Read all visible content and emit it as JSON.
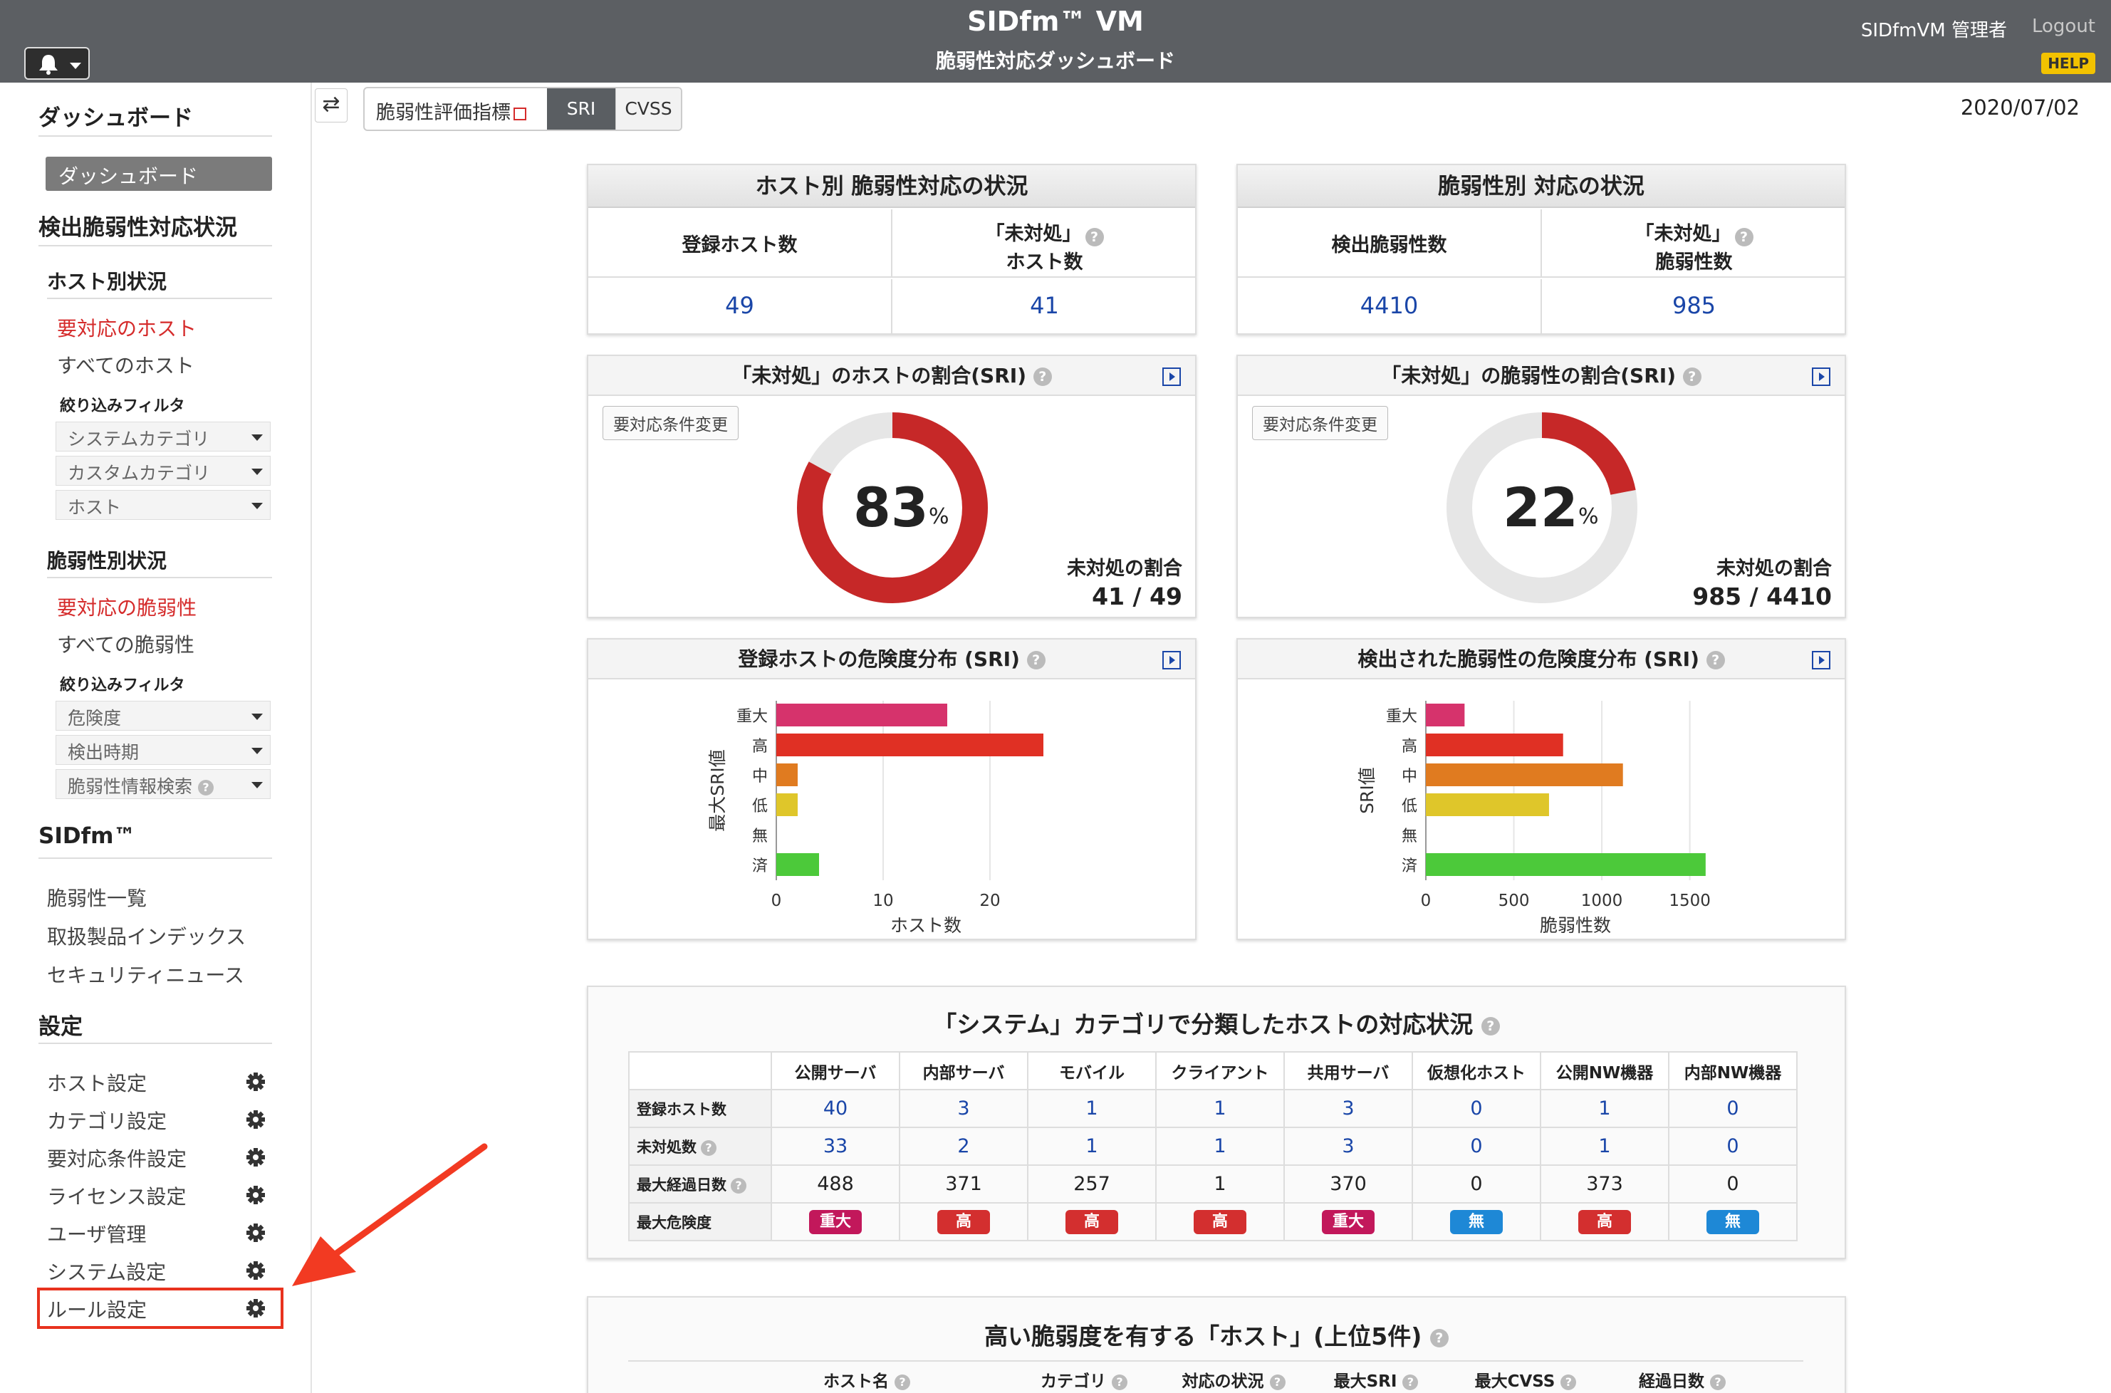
{
  "header": {
    "app_title": "SIDfm™ VM",
    "page_subtitle": "脆弱性対応ダッシュボード",
    "user": "SIDfmVM 管理者",
    "logout": "Logout",
    "help": "HELP",
    "bell_icon": "bell-icon"
  },
  "sidebar": {
    "dashboard_heading": "ダッシュボード",
    "dashboard_active": "ダッシュボード",
    "detect_heading": "検出脆弱性対応状況",
    "host_section": "ホスト別状況",
    "host_links": [
      "要対応のホスト",
      "すべてのホスト"
    ],
    "host_filter_label": "絞り込みフィルタ",
    "host_filters": [
      "システムカテゴリ",
      "カスタムカテゴリ",
      "ホスト"
    ],
    "vuln_section": "脆弱性別状況",
    "vuln_links": [
      "要対応の脆弱性",
      "すべての脆弱性"
    ],
    "vuln_filter_label": "絞り込みフィルタ",
    "vuln_filters": [
      "危険度",
      "検出時期",
      "脆弱性情報検索"
    ],
    "sidfm_heading": "SIDfm™",
    "sidfm_links": [
      "脆弱性一覧",
      "取扱製品インデックス",
      "セキュリティニュース"
    ],
    "settings_heading": "設定",
    "settings_links": [
      "ホスト設定",
      "カテゴリ設定",
      "要対応条件設定",
      "ライセンス設定",
      "ユーザ管理",
      "システム設定",
      "ルール設定"
    ]
  },
  "toolbar": {
    "swap_icon": "⇄",
    "metric_label": "脆弱性評価指標",
    "seg_sri": "SRI",
    "seg_cvss": "CVSS",
    "date": "2020/07/02"
  },
  "host_summary": {
    "title": "ホスト別 脆弱性対応の状況",
    "registered_label": "登録ホスト数",
    "unhandled_label_1": "「未対処」",
    "unhandled_label_2": "ホスト数",
    "registered_value": "49",
    "unhandled_value": "41"
  },
  "vuln_summary": {
    "title": "脆弱性別 対応の状況",
    "detected_label": "検出脆弱性数",
    "unhandled_label_1": "「未対処」",
    "unhandled_label_2": "脆弱性数",
    "detected_value": "4410",
    "unhandled_value": "985"
  },
  "host_ratio": {
    "title": "「未対処」のホストの割合(SRI)",
    "button": "要対応条件変更",
    "percent": 83,
    "percent_text": "83",
    "pct_sign": "%",
    "ratio_label": "未対処の割合",
    "ratio_value": "41 / 49",
    "color": "#c62828"
  },
  "vuln_ratio": {
    "title": "「未対処」の脆弱性の割合(SRI)",
    "button": "要対応条件変更",
    "percent": 22,
    "percent_text": "22",
    "pct_sign": "%",
    "ratio_label": "未対処の割合",
    "ratio_value": "985 / 4410",
    "color": "#c62828"
  },
  "chart_data": [
    {
      "type": "bar",
      "orientation": "horizontal",
      "title": "登録ホストの危険度分布 (SRI)",
      "categories": [
        "重大",
        "高",
        "中",
        "低",
        "無",
        "済"
      ],
      "values": [
        16,
        25,
        2,
        2,
        0,
        4
      ],
      "colors": [
        "#d6336c",
        "#e03024",
        "#e07b20",
        "#dfc62a",
        "#bbbbbb",
        "#4cc93a"
      ],
      "xlabel": "ホスト数",
      "ylabel": "最大SRI値",
      "xticks": [
        0,
        10,
        20
      ],
      "xlim": [
        0,
        28
      ],
      "grid": true
    },
    {
      "type": "bar",
      "orientation": "horizontal",
      "title": "検出された脆弱性の危険度分布 (SRI)",
      "categories": [
        "重大",
        "高",
        "中",
        "低",
        "無",
        "済"
      ],
      "values": [
        220,
        780,
        1120,
        700,
        0,
        1590
      ],
      "colors": [
        "#d6336c",
        "#e03024",
        "#e07b20",
        "#dfc62a",
        "#bbbbbb",
        "#4cc93a"
      ],
      "xlabel": "脆弱性数",
      "ylabel": "SRI値",
      "xticks": [
        0,
        500,
        1000,
        1500
      ],
      "xlim": [
        0,
        1700
      ],
      "grid": true
    }
  ],
  "category_table": {
    "title": "「システム」カテゴリで分類したホストの対応状況",
    "columns": [
      "公開サーバ",
      "内部サーバ",
      "モバイル",
      "クライアント",
      "共用サーバ",
      "仮想化ホスト",
      "公開NW機器",
      "内部NW機器"
    ],
    "rows": [
      {
        "label": "登録ホスト数",
        "help": false,
        "link": true,
        "values": [
          "40",
          "3",
          "1",
          "1",
          "3",
          "0",
          "1",
          "0"
        ]
      },
      {
        "label": "未対処数",
        "help": true,
        "link": true,
        "values": [
          "33",
          "2",
          "1",
          "1",
          "3",
          "0",
          "1",
          "0"
        ]
      },
      {
        "label": "最大経過日数",
        "help": true,
        "link": false,
        "values": [
          "488",
          "371",
          "257",
          "1",
          "370",
          "0",
          "373",
          "0"
        ]
      }
    ],
    "risk_label": "最大危険度",
    "risk": [
      {
        "text": "重大",
        "color": "#c2185b"
      },
      {
        "text": "高",
        "color": "#d32f2f"
      },
      {
        "text": "高",
        "color": "#d32f2f"
      },
      {
        "text": "高",
        "color": "#d32f2f"
      },
      {
        "text": "重大",
        "color": "#c2185b"
      },
      {
        "text": "無",
        "color": "#1e88d6"
      },
      {
        "text": "高",
        "color": "#d32f2f"
      },
      {
        "text": "無",
        "color": "#1e88d6"
      }
    ]
  },
  "top5": {
    "title": "高い脆弱度を有する「ホスト」(上位5件)",
    "columns": [
      "ホスト名",
      "カテゴリ",
      "対応の状況",
      "最大SRI",
      "最大CVSS",
      "経過日数"
    ]
  },
  "colors": {
    "header_bg": "#5c5f63",
    "link_blue": "#1a46a8",
    "active_red": "#d52b2b",
    "highlight": "#e8321e"
  }
}
